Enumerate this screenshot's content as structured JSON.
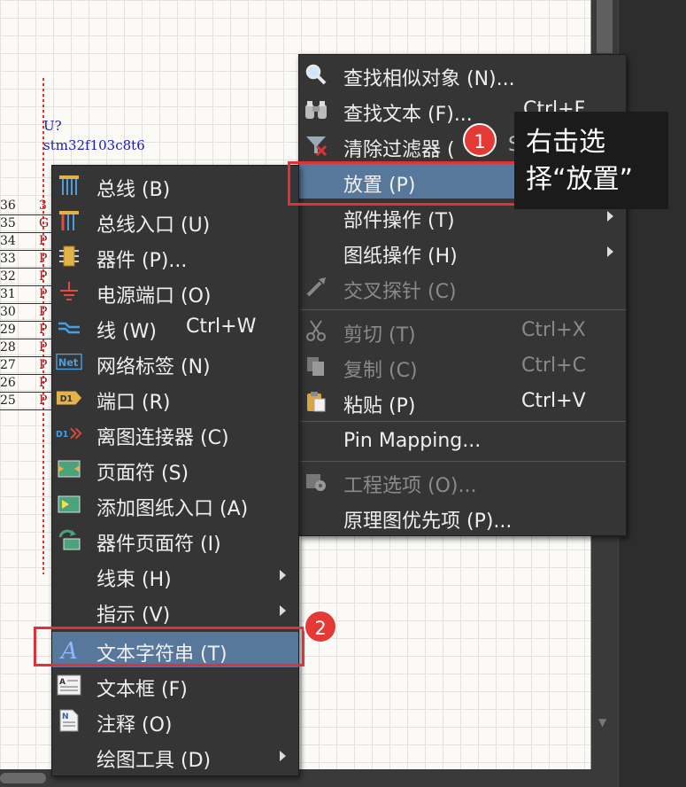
{
  "schematic": {
    "designator": "U?",
    "part_name": "stm32f103c8t6",
    "pins": [
      {
        "num": "36",
        "letter": "3"
      },
      {
        "num": "35",
        "letter": "G"
      },
      {
        "num": "34",
        "letter": "P"
      },
      {
        "num": "33",
        "letter": "P"
      },
      {
        "num": "32",
        "letter": "P"
      },
      {
        "num": "31",
        "letter": "P"
      },
      {
        "num": "30",
        "letter": "P"
      },
      {
        "num": "29",
        "letter": "P"
      },
      {
        "num": "28",
        "letter": "P"
      },
      {
        "num": "27",
        "letter": "P"
      },
      {
        "num": "26",
        "letter": "P"
      },
      {
        "num": "25",
        "letter": "P"
      }
    ]
  },
  "context_menu": {
    "items": [
      {
        "label": "查找相似对象 (N)...",
        "shortcut": "",
        "icon": "search-icon",
        "state": "normal"
      },
      {
        "label": "查找文本 (F)...",
        "shortcut": "Ctrl+F",
        "icon": "binoculars-icon",
        "state": "normal"
      },
      {
        "label": "清除过滤器 (",
        "shortcut": "S",
        "icon": "clear-filter-icon",
        "state": "normal"
      },
      {
        "label": "放置 (P)",
        "shortcut": "",
        "icon": "",
        "state": "highlighted"
      },
      {
        "label": "部件操作 (T)",
        "shortcut": "",
        "icon": "",
        "state": "submenu"
      },
      {
        "label": "图纸操作 (H)",
        "shortcut": "",
        "icon": "",
        "state": "submenu"
      },
      {
        "label": "交叉探针 (C)",
        "shortcut": "",
        "icon": "probe-icon",
        "state": "disabled"
      },
      {
        "label": "剪切 (T)",
        "shortcut": "Ctrl+X",
        "icon": "scissors-icon",
        "state": "disabled"
      },
      {
        "label": "复制 (C)",
        "shortcut": "Ctrl+C",
        "icon": "copy-icon",
        "state": "disabled"
      },
      {
        "label": "粘贴 (P)",
        "shortcut": "Ctrl+V",
        "icon": "paste-icon",
        "state": "normal"
      },
      {
        "label": "Pin Mapping...",
        "shortcut": "",
        "icon": "",
        "state": "normal"
      },
      {
        "label": "工程选项 (O)...",
        "shortcut": "",
        "icon": "project-options-icon",
        "state": "disabled"
      },
      {
        "label": "原理图优先项 (P)...",
        "shortcut": "",
        "icon": "",
        "state": "normal"
      }
    ]
  },
  "place_submenu": {
    "items": [
      {
        "label": "总线 (B)",
        "shortcut": "",
        "icon": "bus-icon",
        "state": "normal"
      },
      {
        "label": "总线入口 (U)",
        "shortcut": "",
        "icon": "bus-entry-icon",
        "state": "normal"
      },
      {
        "label": "器件 (P)...",
        "shortcut": "",
        "icon": "part-icon",
        "state": "normal"
      },
      {
        "label": "电源端口 (O)",
        "shortcut": "",
        "icon": "power-port-icon",
        "state": "normal"
      },
      {
        "label": "线 (W)",
        "shortcut": "Ctrl+W",
        "icon": "wire-icon",
        "state": "normal"
      },
      {
        "label": "网络标签 (N)",
        "shortcut": "",
        "icon": "net-label-icon",
        "state": "normal"
      },
      {
        "label": "端口 (R)",
        "shortcut": "",
        "icon": "port-icon",
        "state": "normal"
      },
      {
        "label": "离图连接器 (C)",
        "shortcut": "",
        "icon": "off-sheet-connector-icon",
        "state": "normal"
      },
      {
        "label": "页面符 (S)",
        "shortcut": "",
        "icon": "sheet-symbol-icon",
        "state": "normal"
      },
      {
        "label": "添加图纸入口 (A)",
        "shortcut": "",
        "icon": "sheet-entry-icon",
        "state": "normal"
      },
      {
        "label": "器件页面符 (I)",
        "shortcut": "",
        "icon": "device-sheet-symbol-icon",
        "state": "normal"
      },
      {
        "label": "线束 (H)",
        "shortcut": "",
        "icon": "",
        "state": "submenu"
      },
      {
        "label": "指示 (V)",
        "shortcut": "",
        "icon": "",
        "state": "submenu"
      },
      {
        "label": "文本字符串 (T)",
        "shortcut": "",
        "icon": "text-string-icon",
        "state": "highlighted"
      },
      {
        "label": "文本框 (F)",
        "shortcut": "",
        "icon": "text-frame-icon",
        "state": "normal"
      },
      {
        "label": "注释 (O)",
        "shortcut": "",
        "icon": "note-icon",
        "state": "normal"
      },
      {
        "label": "绘图工具 (D)",
        "shortcut": "",
        "icon": "",
        "state": "submenu"
      }
    ]
  },
  "annotations": {
    "callout_line1": "右击选",
    "callout_line2": "择“放置”",
    "step1": "1",
    "step2": "2"
  },
  "colors": {
    "highlight": "#57789a",
    "annotation_red": "#e0303a",
    "menu_bg": "#353535"
  }
}
